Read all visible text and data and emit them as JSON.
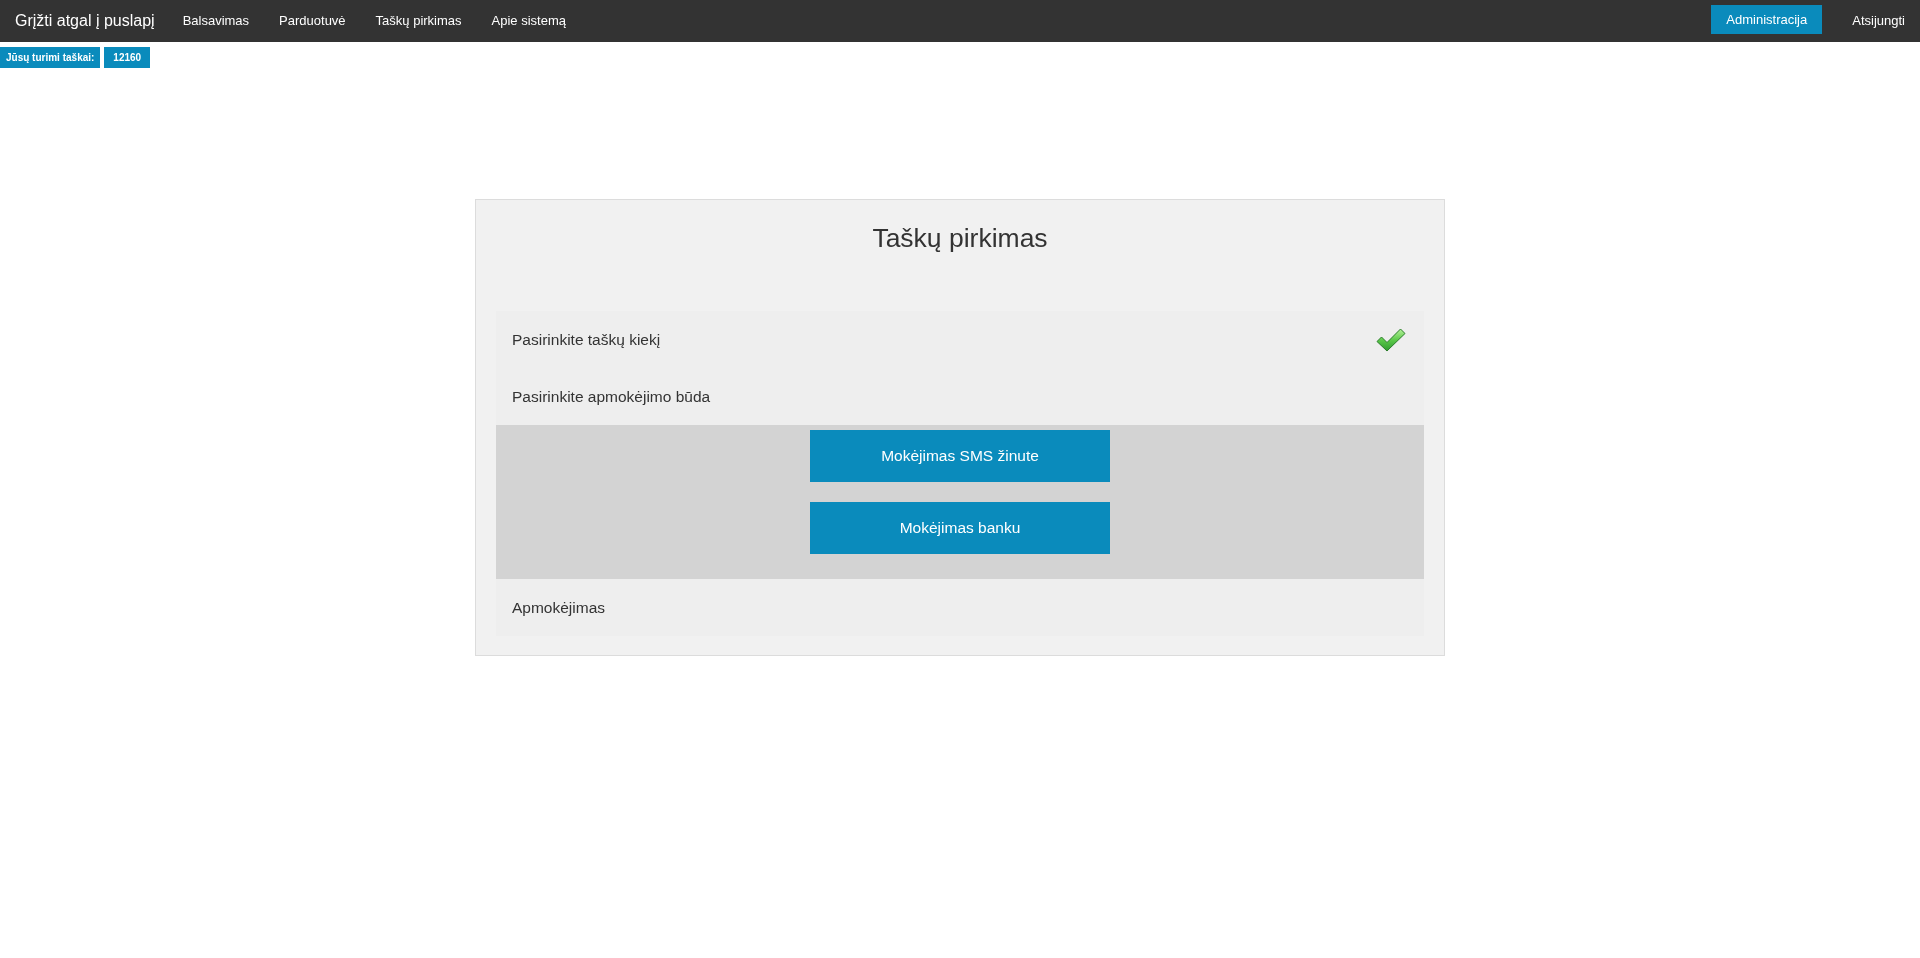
{
  "navbar": {
    "brand": "Grįžti atgal į puslapį",
    "links": [
      "Balsavimas",
      "Parduotuvė",
      "Taškų pirkimas",
      "Apie sistemą"
    ],
    "actions": [
      {
        "label": "Administracija",
        "kind": "button"
      },
      {
        "label": "Atsijungti",
        "kind": "link"
      }
    ]
  },
  "points": {
    "label": "Jūsų turimi taškai:",
    "value": "12160"
  },
  "purchase": {
    "title": "Taškų pirkimas",
    "steps": [
      {
        "label": "Pasirinkite taškų kiekį",
        "completed": true
      },
      {
        "label": "Pasirinkite apmokėjimo būda",
        "completed": false,
        "options": [
          "Mokėjimas SMS žinute",
          "Mokėjimas banku"
        ]
      },
      {
        "label": "Apmokėjimas",
        "completed": false
      }
    ]
  }
}
